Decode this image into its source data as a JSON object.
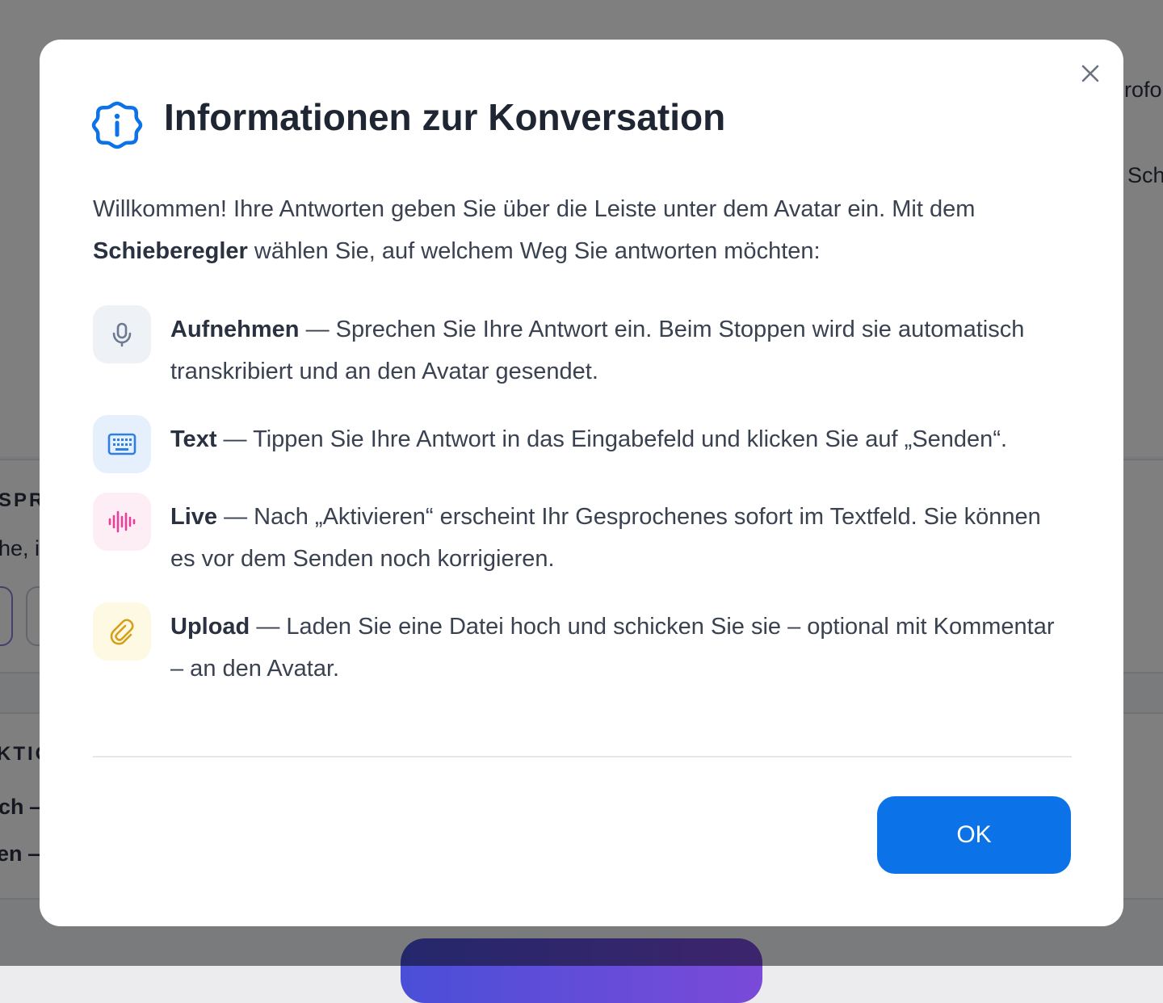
{
  "background": {
    "fragments": [
      "rofon",
      "Sch",
      "SPR",
      "he, i",
      "KTIO",
      "ch —",
      "en —"
    ]
  },
  "modal": {
    "title": "Informationen zur Konversation",
    "intro_part1": "Willkommen! Ihre Antworten geben Sie über die Leiste unter dem Avatar ein. Mit dem",
    "intro_bold": "Schieberegler",
    "intro_part2": "wählen Sie, auf welchem Weg Sie antworten möchten:",
    "items": [
      {
        "label": "Aufnehmen",
        "text": "— Sprechen Sie Ihre Antwort ein. Beim Stoppen wird sie automatisch transkribiert und an den Avatar gesendet.",
        "icon": "microphone-icon",
        "icon_color": "#6b7a90",
        "icon_bg": "#eef1f6"
      },
      {
        "label": "Text",
        "text": "— Tippen Sie Ihre Antwort in das Eingabefeld und klicken Sie auf „Senden“.",
        "icon": "keyboard-icon",
        "icon_color": "#2f7fe0",
        "icon_bg": "#e6f0fd"
      },
      {
        "label": "Live",
        "text": "— Nach „Aktivieren“ erscheint Ihr Gesprochenes sofort im Textfeld. Sie können es vor dem Senden noch korrigieren.",
        "icon": "soundwave-icon",
        "icon_color": "#e8409a",
        "icon_bg": "#fdeef6"
      },
      {
        "label": "Upload",
        "text": "— Laden Sie eine Datei hoch und schicken Sie sie – optional mit Kommentar – an den Avatar.",
        "icon": "paperclip-icon",
        "icon_color": "#d4a017",
        "icon_bg": "#fdf9e3"
      }
    ],
    "ok_label": "OK",
    "accent_color": "#0b72e8"
  }
}
